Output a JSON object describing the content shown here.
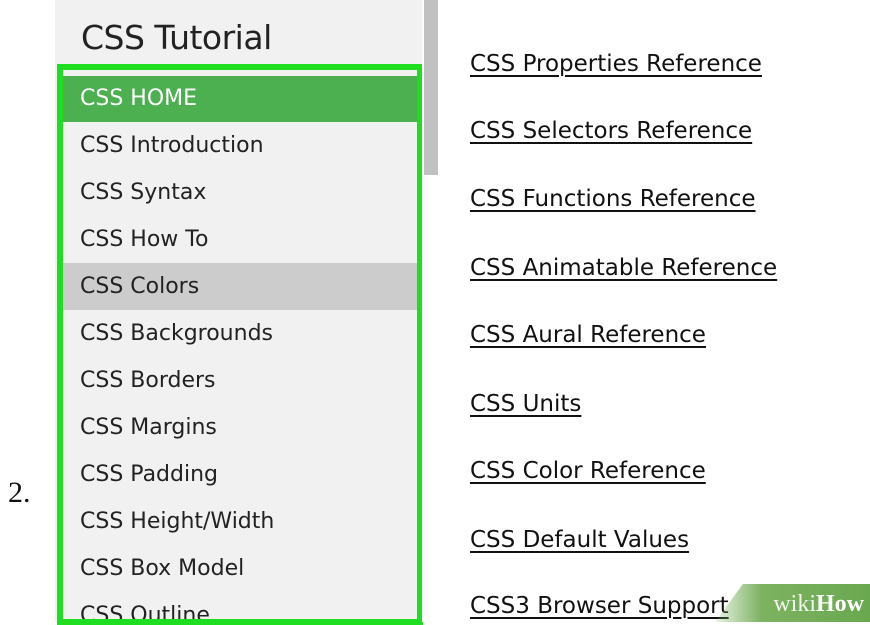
{
  "step_number": "2.",
  "sidebar": {
    "title": "CSS Tutorial",
    "items": [
      {
        "label": "CSS HOME",
        "state": "active"
      },
      {
        "label": "CSS Introduction",
        "state": "normal"
      },
      {
        "label": "CSS Syntax",
        "state": "normal"
      },
      {
        "label": "CSS How To",
        "state": "normal"
      },
      {
        "label": "CSS Colors",
        "state": "hover"
      },
      {
        "label": "CSS Backgrounds",
        "state": "normal"
      },
      {
        "label": "CSS Borders",
        "state": "normal"
      },
      {
        "label": "CSS Margins",
        "state": "normal"
      },
      {
        "label": "CSS Padding",
        "state": "normal"
      },
      {
        "label": "CSS Height/Width",
        "state": "normal"
      },
      {
        "label": "CSS Box Model",
        "state": "normal"
      },
      {
        "label": "CSS Outline",
        "state": "normal"
      }
    ]
  },
  "reference_links": [
    "CSS Properties Reference",
    "CSS Selectors Reference",
    "CSS Functions Reference",
    "CSS Animatable Reference",
    "CSS Aural Reference",
    "CSS Units",
    "CSS Color Reference",
    "CSS Default Values",
    "CSS3 Browser Support"
  ],
  "watermark": {
    "part1": "wiki",
    "part2": "How"
  },
  "colors": {
    "highlight_border": "#1fdd1f",
    "active_item": "#4caf50",
    "hover_item": "#cccccc",
    "sidebar_bg": "#f1f1f1"
  }
}
